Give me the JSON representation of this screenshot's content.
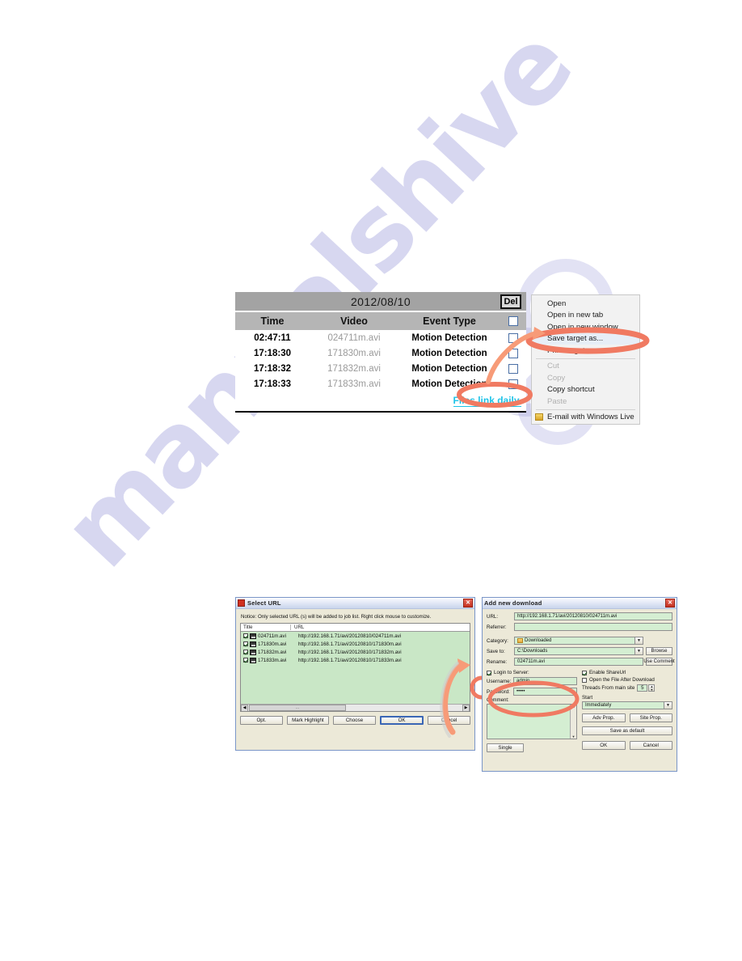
{
  "watermark": {
    "text": "manualshive"
  },
  "event_panel": {
    "date": "2012/08/10",
    "delete_button": "Del",
    "columns": {
      "time": "Time",
      "video": "Video",
      "event": "Event Type"
    },
    "rows": [
      {
        "time": "02:47:11",
        "video": "024711m.avi",
        "event": "Motion Detection"
      },
      {
        "time": "17:18:30",
        "video": "171830m.avi",
        "event": "Motion Detection"
      },
      {
        "time": "17:18:32",
        "video": "171832m.avi",
        "event": "Motion Detection"
      },
      {
        "time": "17:18:33",
        "video": "171833m.avi",
        "event": "Motion Detection"
      }
    ],
    "footer_link": "Files link daily."
  },
  "context_menu": {
    "items": [
      {
        "label": "Open",
        "state": "normal"
      },
      {
        "label": "Open in new tab",
        "state": "normal"
      },
      {
        "label": "Open in new window",
        "state": "normal"
      },
      {
        "label": "Save target as...",
        "state": "highlighted"
      },
      {
        "label": "Print target",
        "state": "normal"
      },
      {
        "label": "Cut",
        "state": "disabled"
      },
      {
        "label": "Copy",
        "state": "disabled"
      },
      {
        "label": "Copy shortcut",
        "state": "normal"
      },
      {
        "label": "Paste",
        "state": "disabled"
      },
      {
        "label": "E-mail with Windows Live",
        "state": "normal"
      }
    ]
  },
  "select_url_dialog": {
    "title": "Select URL",
    "close": "✕",
    "notice": "Notice: Only selected URL (s) will be added to job list. Right click mouse to customize.",
    "columns": {
      "title": "Title",
      "url": "URL"
    },
    "rows": [
      {
        "title": "024711m.avi",
        "url": "http://192.168.1.71/avi/20120810/024711m.avi"
      },
      {
        "title": "171830m.avi",
        "url": "http://192.168.1.71/avi/20120810/171830m.avi"
      },
      {
        "title": "171832m.avi",
        "url": "http://192.168.1.71/avi/20120810/171832m.avi"
      },
      {
        "title": "171833m.avi",
        "url": "http://192.168.1.71/avi/20120810/171833m.avi"
      }
    ],
    "scroll_label": "...",
    "buttons": {
      "opt": "Opt.",
      "mark_highlight": "Mark Highlight",
      "choose": "Choose",
      "ok": "OK",
      "cancel": "Cancel"
    }
  },
  "add_download_dialog": {
    "title": "Add new download",
    "close": "✕",
    "fields": {
      "url_label": "URL:",
      "url_value": "http://192.168.1.71/avi/20120810/024711m.avi",
      "referrer_label": "Referrer:",
      "referrer_value": "",
      "category_label": "Category:",
      "category_value": "Downloaded",
      "save_to_label": "Save to:",
      "save_to_value": "C:\\Downloads",
      "rename_label": "Rename:",
      "rename_value": "024711m.avi"
    },
    "buttons": {
      "browse": "Browse",
      "use_comment": "Use Comment",
      "adv_prop": "Adv Prop.",
      "site_prop": "Site Prop.",
      "save_as_default": "Save as default",
      "single": "Single",
      "ok": "OK",
      "cancel": "Cancel"
    },
    "login": {
      "login_to_server": "Login to Server:",
      "login_checked": true,
      "username_label": "Username:",
      "username_value": "admin",
      "password_label": "Password:",
      "password_value": "•••••",
      "comment_label": "Comment:"
    },
    "options": {
      "enable_shareurl": "Enable ShareUrl",
      "enable_shareurl_checked": true,
      "open_after": "Open the File After Download",
      "open_after_checked": false,
      "threads_label": "Threads From main site",
      "threads_value": "5",
      "start_label": "Start",
      "start_value": "Immediately"
    }
  },
  "colors": {
    "annotation": "#f07a62",
    "link": "#1ec3e8",
    "panel_header": "#a3a3a3",
    "list_green": "#c9e7c6"
  }
}
